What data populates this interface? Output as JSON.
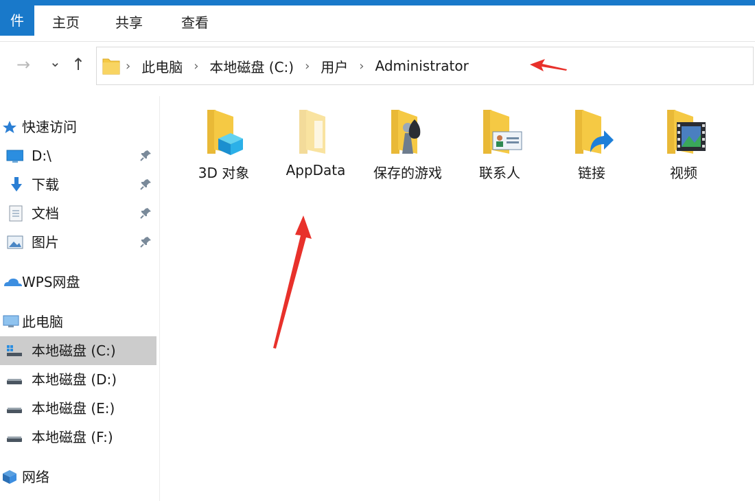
{
  "ribbon": {
    "file_label": "件",
    "tabs": [
      "主页",
      "共享",
      "查看"
    ]
  },
  "nav": {
    "back": "←",
    "forward": "→",
    "recent": "⌄",
    "up": "↑"
  },
  "breadcrumb": {
    "sep": "›",
    "items": [
      "此电脑",
      "本地磁盘 (C:)",
      "用户",
      "Administrator"
    ]
  },
  "sidebar": {
    "quick_access": "快速访问",
    "pinned": [
      "D:\\",
      "下载",
      "文档",
      "图片"
    ],
    "wps": "WPS网盘",
    "this_pc": "此电脑",
    "drives": [
      "本地磁盘 (C:)",
      "本地磁盘 (D:)",
      "本地磁盘 (E:)",
      "本地磁盘 (F:)"
    ],
    "network": "网络"
  },
  "folders": [
    "3D 对象",
    "AppData",
    "保存的游戏",
    "联系人",
    "链接",
    "视频"
  ],
  "colors": {
    "accent": "#1979ca",
    "folder": "#f5c944",
    "selection": "#cccccc",
    "annotation": "#e8312b"
  }
}
